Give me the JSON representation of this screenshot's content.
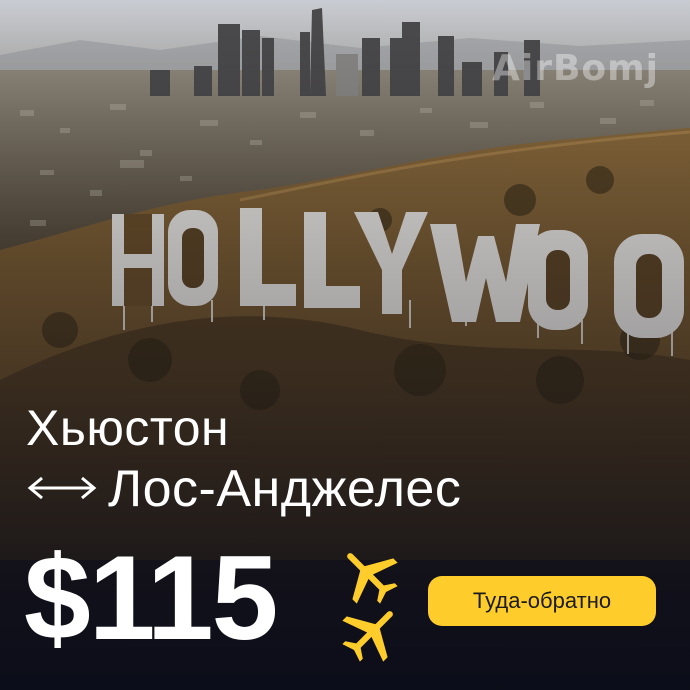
{
  "ad": {
    "watermark": "AirBomj",
    "origin": "Хьюстон",
    "destination": "Лос-Анджелес",
    "price": "$115",
    "trip_type": "Туда-обратно",
    "sign_letters": [
      "H",
      "O",
      "L",
      "L",
      "Y",
      "W",
      "O",
      "O"
    ]
  },
  "colors": {
    "badge": "#ffcd2b",
    "plane_icons": "#ffcd2b",
    "text": "#ffffff"
  },
  "icons": {
    "route": "double-arrow-icon",
    "departure": "airplane-takeoff-icon",
    "arrival": "airplane-landing-icon"
  }
}
